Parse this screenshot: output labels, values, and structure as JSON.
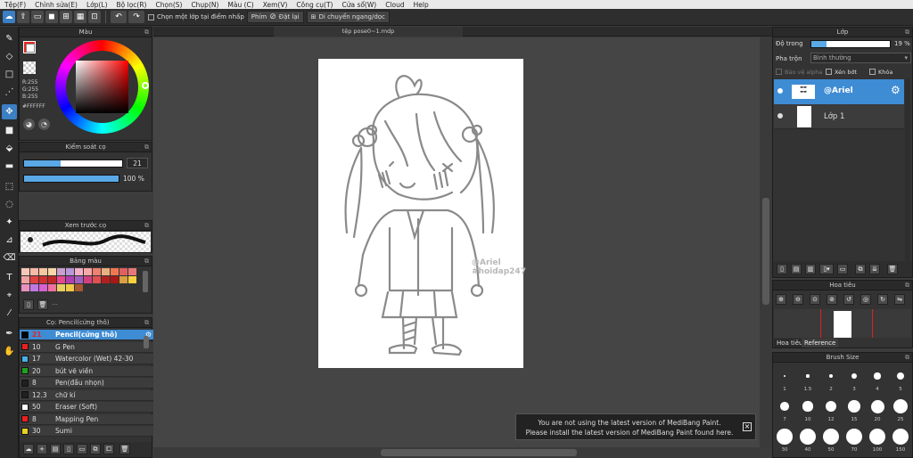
{
  "menu": [
    "Tệp(F)",
    "Chỉnh sửa(E)",
    "Lớp(L)",
    "Bộ lọc(R)",
    "Chọn(S)",
    "Chụp(N)",
    "Màu (C)",
    "Xem(V)",
    "Công cụ(T)",
    "Cửa sổ(W)",
    "Cloud",
    "Help"
  ],
  "toolbar": {
    "select_layer_label": "Chọn một lớp tại điểm nhấp",
    "shortcut_label": "Phím",
    "reset_label": "Đặt lại",
    "move_label": "Di chuyển ngang/dọc"
  },
  "color_panel": {
    "title": "Màu",
    "r": "R:255",
    "g": "G:255",
    "b": "B:255",
    "hex": "#FFFFFF",
    "foreground": "#ffffff",
    "background": "#e8261c"
  },
  "brush_control": {
    "title": "Kiểm soát cọ",
    "size": "21",
    "opacity": "100 %",
    "size_fraction": 0.37,
    "opacity_fraction": 1.0
  },
  "brush_preview": {
    "title": "Xem trước cọ"
  },
  "palette": {
    "title": "Bảng màu",
    "colors": [
      "#f5c8b8",
      "#f7b8a8",
      "#f6c6a0",
      "#f8d6a8",
      "#c8a0d0",
      "#b898d8",
      "#f4b0c8",
      "#f8a8a8",
      "#f08070",
      "#e8b080",
      "#f07850",
      "#e06060",
      "#e87878",
      "#f0a0a0",
      "#e04040",
      "#d03030",
      "#c02828",
      "#e84890",
      "#b040b0",
      "#a060c0",
      "#d04080",
      "#e05050",
      "#b02020",
      "#a81818",
      "#d8a040",
      "#f8d040",
      "#e890c0",
      "#c078e0",
      "#d860d0",
      "#f070a0",
      "#e8d060",
      "#f0c848",
      "#a85830"
    ]
  },
  "brush_list": {
    "title": "Cọ: Pencil(cứng thô)",
    "items": [
      {
        "size": "21",
        "name": "Pencil(cứng thô)",
        "color": "#000000",
        "selected": true
      },
      {
        "size": "10",
        "name": "G Pen",
        "color": "#e82020",
        "selected": false
      },
      {
        "size": "17",
        "name": "Watercolor (Wet) 42-30",
        "color": "#48b0e8",
        "selected": false
      },
      {
        "size": "20",
        "name": "bút vẽ viền",
        "color": "#20a020",
        "selected": false
      },
      {
        "size": "8",
        "name": "Pen(đầu nhọn)",
        "color": "#202020",
        "selected": false
      },
      {
        "size": "12.3",
        "name": "chữ kí",
        "color": "#202020",
        "selected": false
      },
      {
        "size": "50",
        "name": "Eraser (Soft)",
        "color": "#ffffff",
        "selected": false
      },
      {
        "size": "8",
        "name": "Mapping Pen",
        "color": "#e82020",
        "selected": false
      },
      {
        "size": "30",
        "name": "Sumi",
        "color": "#e8d020",
        "selected": false
      }
    ]
  },
  "document": {
    "tab_label": "tệp pose0~1.mdp",
    "watermark_line1": "@Ariel",
    "watermark_line2": "#hoidap247"
  },
  "layer_panel": {
    "title": "Lớp",
    "opacity_label": "Độ trong",
    "opacity_value": "19 %",
    "opacity_fraction": 0.19,
    "blend_label": "Pha trộn",
    "blend_value": "Bình thường",
    "protect_alpha": "Bảo vệ alpha",
    "clipping": "Xén bớt",
    "lock": "Khóa",
    "layers": [
      {
        "name": "@Ariel",
        "selected": true
      },
      {
        "name": "Lớp 1",
        "selected": false
      }
    ]
  },
  "navigator": {
    "title": "Hoa tiêu",
    "tab1": "Hoa tiêu",
    "tab2": "Reference"
  },
  "brush_size": {
    "title": "Brush Size",
    "sizes": [
      "1",
      "1.5",
      "2",
      "3",
      "4",
      "5",
      "7",
      "10",
      "12",
      "15",
      "20",
      "25",
      "30",
      "40",
      "50",
      "70",
      "100",
      "150"
    ]
  },
  "notice": {
    "line1": "You are not using the latest version of MediBang Paint.",
    "line2": "Please install the latest version of MediBang Paint found here."
  }
}
